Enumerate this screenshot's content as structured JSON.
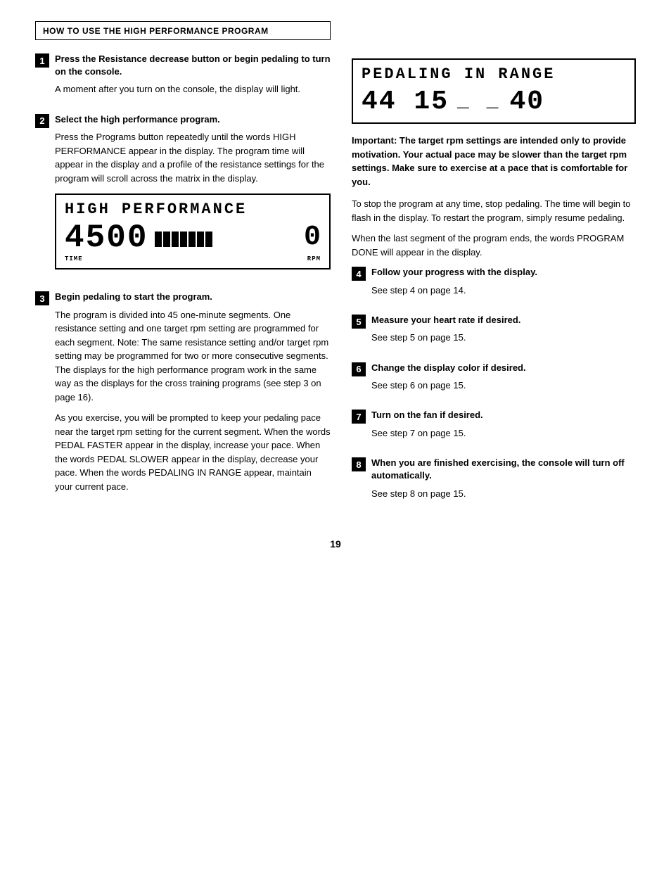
{
  "header": {
    "title": "HOW TO USE THE HIGH PERFORMANCE PROGRAM"
  },
  "left_column": {
    "step1": {
      "number": "1",
      "title": "Press the Resistance decrease button or begin pedaling to turn on the console.",
      "body": "A moment after you turn on the console, the display will light."
    },
    "step2": {
      "number": "2",
      "title": "Select the high performance program.",
      "body": "Press the Programs button repeatedly until the words HIGH PERFORMANCE appear in the display. The program time will appear in the display and a profile of the resistance settings for the program will scroll across the matrix in the display."
    },
    "display1": {
      "top_text": "HIGH PERFORMANCE",
      "numbers": "4500",
      "rpm_value": "0",
      "time_label": "TIME",
      "rpm_label": "RPM"
    },
    "step3": {
      "number": "3",
      "title": "Begin pedaling to start the program.",
      "body1": "The program is divided into 45 one-minute segments. One resistance setting and one target rpm setting are programmed for each segment. Note: The same resistance setting and/or target rpm setting may be programmed for two or more consecutive segments. The displays for the high performance program work in the same way as the displays for the cross training programs (see step 3 on page 16).",
      "body2": "As you exercise, you will be prompted to keep your pedaling pace near the target rpm setting for the current segment. When the words PEDAL FASTER appear in the display, increase your pace. When the words PEDAL SLOWER appear in the display, decrease your pace. When the words PEDALING IN RANGE appear, maintain your current pace."
    }
  },
  "right_column": {
    "display2": {
      "top_text": "PEDALING IN RANGE",
      "bottom_left": "44 15",
      "bottom_dots": "_ _",
      "bottom_right": "40"
    },
    "important": "Important: The target rpm settings are intended only to provide motivation. Your actual pace may be slower than the target rpm settings. Make sure to exercise at a pace that is comfortable for you.",
    "stop_para": "To stop the program at any time, stop pedaling. The time will begin to flash in the display. To restart the program, simply resume pedaling.",
    "done_para": "When the last segment of the program ends, the words PROGRAM DONE will appear in the display.",
    "step4": {
      "number": "4",
      "title": "Follow your progress with the display.",
      "body": "See step 4 on page 14."
    },
    "step5": {
      "number": "5",
      "title": "Measure your heart rate if desired.",
      "body": "See step 5 on page 15."
    },
    "step6": {
      "number": "6",
      "title": "Change the display color if desired.",
      "body": "See step 6 on page 15."
    },
    "step7": {
      "number": "7",
      "title": "Turn on the fan if desired.",
      "body": "See step 7 on page 15."
    },
    "step8": {
      "number": "8",
      "title": "When you are finished exercising, the console will turn off automatically.",
      "body": "See step 8 on page 15."
    }
  },
  "page_number": "19"
}
